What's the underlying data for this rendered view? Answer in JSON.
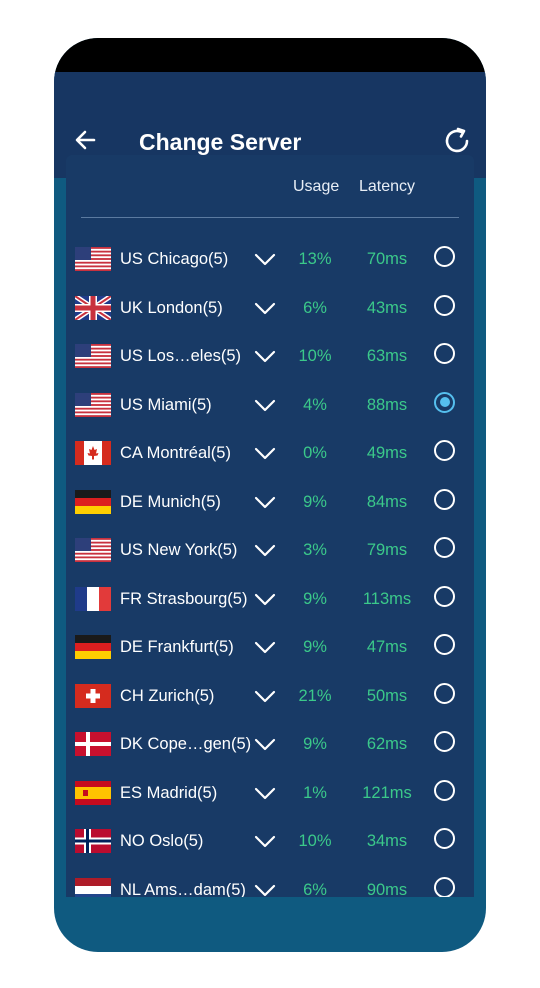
{
  "header": {
    "title": "Change Server",
    "back_icon": "arrow-left-icon",
    "refresh_icon": "refresh-icon"
  },
  "columns": {
    "usage": "Usage",
    "latency": "Latency"
  },
  "colors": {
    "header_bg": "#173662",
    "panel_bg": "#183a66",
    "accent_green": "#3bc98a",
    "selected_blue": "#55bfee"
  },
  "servers": [
    {
      "flag": "us",
      "name": "US Chicago(5)",
      "usage": "13%",
      "latency": "70ms",
      "selected": false
    },
    {
      "flag": "uk",
      "name": "UK London(5)",
      "usage": "6%",
      "latency": "43ms",
      "selected": false
    },
    {
      "flag": "us",
      "name": "US Los…eles(5)",
      "usage": "10%",
      "latency": "63ms",
      "selected": false
    },
    {
      "flag": "us",
      "name": "US Miami(5)",
      "usage": "4%",
      "latency": "88ms",
      "selected": true
    },
    {
      "flag": "ca",
      "name": "CA Montréal(5)",
      "usage": "0%",
      "latency": "49ms",
      "selected": false
    },
    {
      "flag": "de",
      "name": "DE Munich(5)",
      "usage": "9%",
      "latency": "84ms",
      "selected": false
    },
    {
      "flag": "us",
      "name": "US New York(5)",
      "usage": "3%",
      "latency": "79ms",
      "selected": false
    },
    {
      "flag": "fr",
      "name": "FR Strasbourg(5)",
      "usage": "9%",
      "latency": "113ms",
      "selected": false
    },
    {
      "flag": "de",
      "name": "DE Frankfurt(5)",
      "usage": "9%",
      "latency": "47ms",
      "selected": false
    },
    {
      "flag": "ch",
      "name": "CH Zurich(5)",
      "usage": "21%",
      "latency": "50ms",
      "selected": false
    },
    {
      "flag": "dk",
      "name": "DK Cope…gen(5)",
      "usage": "9%",
      "latency": "62ms",
      "selected": false
    },
    {
      "flag": "es",
      "name": "ES Madrid(5)",
      "usage": "1%",
      "latency": "121ms",
      "selected": false
    },
    {
      "flag": "no",
      "name": "NO Oslo(5)",
      "usage": "10%",
      "latency": "34ms",
      "selected": false
    },
    {
      "flag": "nl",
      "name": "NL Ams…dam(5)",
      "usage": "6%",
      "latency": "90ms",
      "selected": false
    }
  ]
}
